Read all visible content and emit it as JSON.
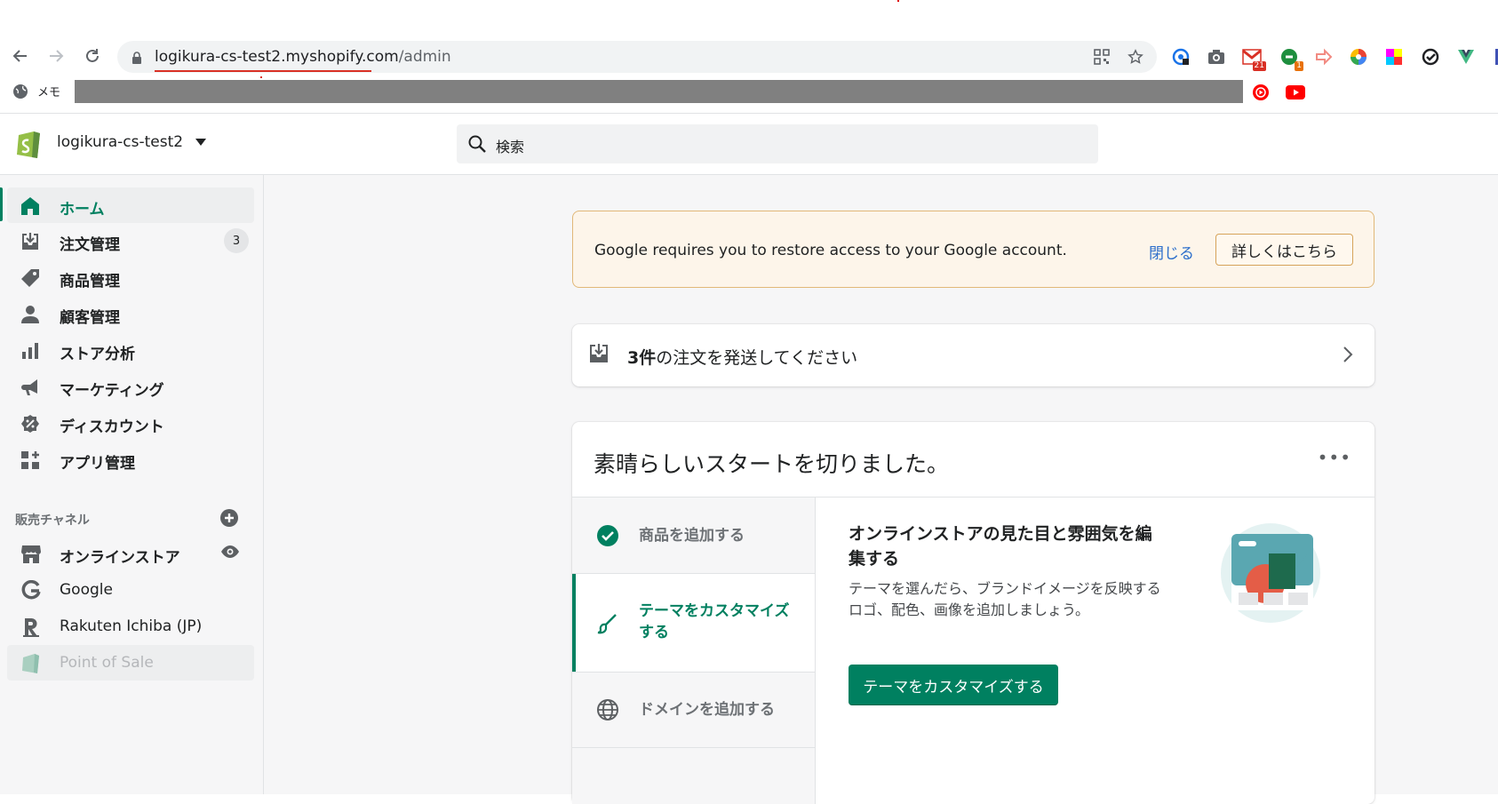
{
  "browser": {
    "url_domain": "logikura-cs-test2.myshopify.com",
    "url_path": "/admin",
    "bookmark_memo": "メモ",
    "extensions": [
      {
        "name": "password-manager-icon"
      },
      {
        "name": "camera-icon"
      },
      {
        "name": "gmail-icon",
        "badge": "21"
      },
      {
        "name": "green-circle-extension-icon",
        "badge": "1"
      },
      {
        "name": "share-arrow-extension-icon"
      },
      {
        "name": "color-wheel-icon"
      },
      {
        "name": "color-palette-icon"
      },
      {
        "name": "check-circle-extension-icon"
      },
      {
        "name": "vue-devtools-icon"
      }
    ],
    "colors": {
      "badge_red": "#d93025",
      "badge_orange": "#e8710a"
    }
  },
  "topbar": {
    "store_name": "logikura-cs-test2",
    "search_placeholder": "検索"
  },
  "sidebar": {
    "items": [
      {
        "label": "ホーム",
        "icon": "home-icon",
        "active": true
      },
      {
        "label": "注文管理",
        "icon": "orders-icon",
        "count": "3"
      },
      {
        "label": "商品管理",
        "icon": "tag-icon"
      },
      {
        "label": "顧客管理",
        "icon": "person-icon"
      },
      {
        "label": "ストア分析",
        "icon": "bar-chart-icon"
      },
      {
        "label": "マーケティング",
        "icon": "megaphone-icon"
      },
      {
        "label": "ディスカウント",
        "icon": "discount-icon"
      },
      {
        "label": "アプリ管理",
        "icon": "apps-icon"
      }
    ],
    "channels_heading": "販売チャネル",
    "channels": [
      {
        "label": "オンラインストア",
        "icon": "store-icon"
      },
      {
        "label": "Google",
        "icon": "google-icon"
      },
      {
        "label": "Rakuten Ichiba (JP)",
        "icon": "rakuten-icon"
      },
      {
        "label": "Point of Sale",
        "icon": "pos-icon",
        "disabled": true
      }
    ]
  },
  "banner": {
    "message": "Google requires you to restore access to your Google account.",
    "dismiss_label": "閉じる",
    "learn_more_label": "詳しくはこちら"
  },
  "orders_card": {
    "count": "3件",
    "message": "の注文を発送してください"
  },
  "setup": {
    "title": "素晴らしいスタートを切りました。",
    "more": "•••",
    "steps": [
      {
        "label": "商品を追加する",
        "icon": "check-circle-icon",
        "completed": true
      },
      {
        "label": "テーマをカスタマイズする",
        "icon": "brush-icon",
        "active": true
      },
      {
        "label": "ドメインを追加する",
        "icon": "globe-icon"
      }
    ],
    "detail": {
      "title": "オンラインストアの見た目と雰囲気を編集する",
      "description": "テーマを選んだら、ブランドイメージを反映するロゴ、配色、画像を追加しましょう。",
      "button_label": "テーマをカスタマイズする"
    }
  },
  "colors": {
    "accent": "#008060",
    "banner_bg": "#fdf5ea",
    "link": "#2c6ecb"
  }
}
